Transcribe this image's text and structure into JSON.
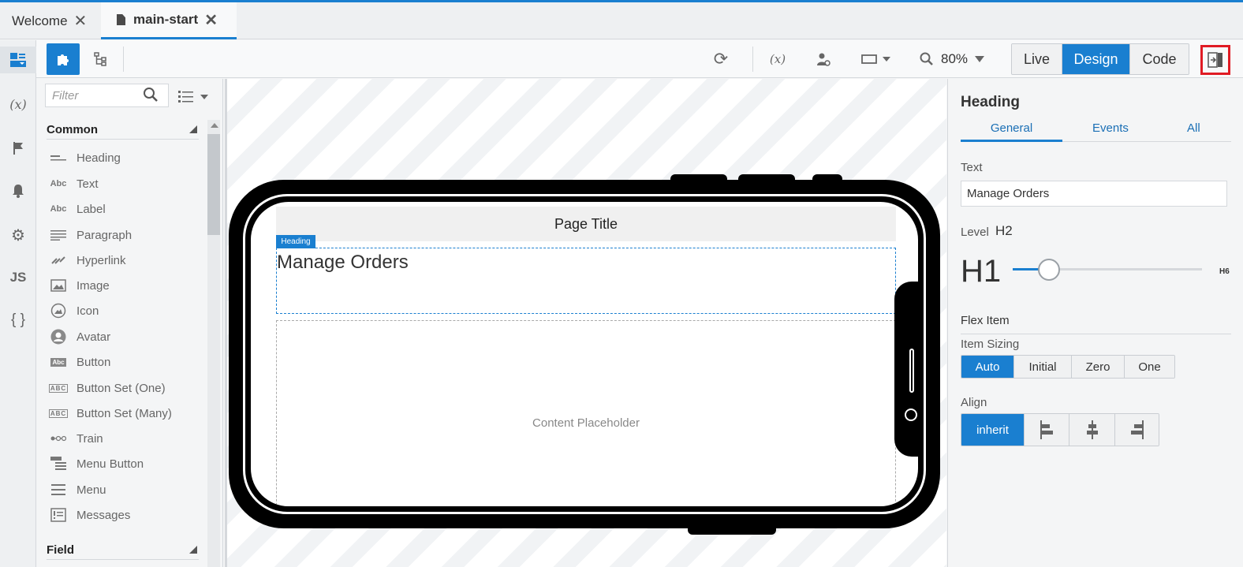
{
  "tabs": [
    {
      "label": "Welcome",
      "close": "✕"
    },
    {
      "label": "main-start",
      "close": "✕"
    }
  ],
  "toolbar": {
    "zoom": "80%",
    "modes": [
      "Live",
      "Design",
      "Code"
    ],
    "active_mode": "Design"
  },
  "rail": {
    "items": [
      "components-icon",
      "variables-icon",
      "flag-icon",
      "bell-icon",
      "gear-icon",
      "javascript-icon",
      "json-icon"
    ],
    "variables_glyph": "(x)",
    "js_glyph": "JS",
    "json_glyph": "{ }"
  },
  "palette": {
    "filter_placeholder": "Filter",
    "section_common": "Common",
    "section_field": "Field",
    "items": [
      {
        "label": "Heading",
        "icon": "heading-icon"
      },
      {
        "label": "Text",
        "icon": "text-icon"
      },
      {
        "label": "Label",
        "icon": "label-icon"
      },
      {
        "label": "Paragraph",
        "icon": "paragraph-icon"
      },
      {
        "label": "Hyperlink",
        "icon": "hyperlink-icon"
      },
      {
        "label": "Image",
        "icon": "image-icon"
      },
      {
        "label": "Icon",
        "icon": "icon-icon"
      },
      {
        "label": "Avatar",
        "icon": "avatar-icon"
      },
      {
        "label": "Button",
        "icon": "button-icon"
      },
      {
        "label": "Button Set (One)",
        "icon": "button-set-one-icon"
      },
      {
        "label": "Button Set (Many)",
        "icon": "button-set-many-icon"
      },
      {
        "label": "Train",
        "icon": "train-icon"
      },
      {
        "label": "Menu Button",
        "icon": "menu-button-icon"
      },
      {
        "label": "Menu",
        "icon": "menu-icon"
      },
      {
        "label": "Messages",
        "icon": "messages-icon"
      }
    ]
  },
  "canvas": {
    "page_title": "Page Title",
    "heading_badge": "Heading",
    "heading_text": "Manage Orders",
    "content_placeholder": "Content Placeholder"
  },
  "props": {
    "title": "Heading",
    "tabs": [
      "General",
      "Events",
      "All"
    ],
    "text_label": "Text",
    "text_value": "Manage Orders",
    "level_label": "Level",
    "level_value": "H2",
    "level_min": "H1",
    "level_max": "H6",
    "flex_item_label": "Flex Item",
    "item_sizing_label": "Item Sizing",
    "item_sizing_options": [
      "Auto",
      "Initial",
      "Zero",
      "One"
    ],
    "item_sizing_selected": "Auto",
    "align_label": "Align",
    "align_options": [
      "inherit",
      "align-start-icon",
      "align-center-icon",
      "align-end-icon"
    ],
    "align_selected": "inherit"
  },
  "colors": {
    "accent": "#1a7fd0",
    "highlight_box": "#e01b24"
  }
}
